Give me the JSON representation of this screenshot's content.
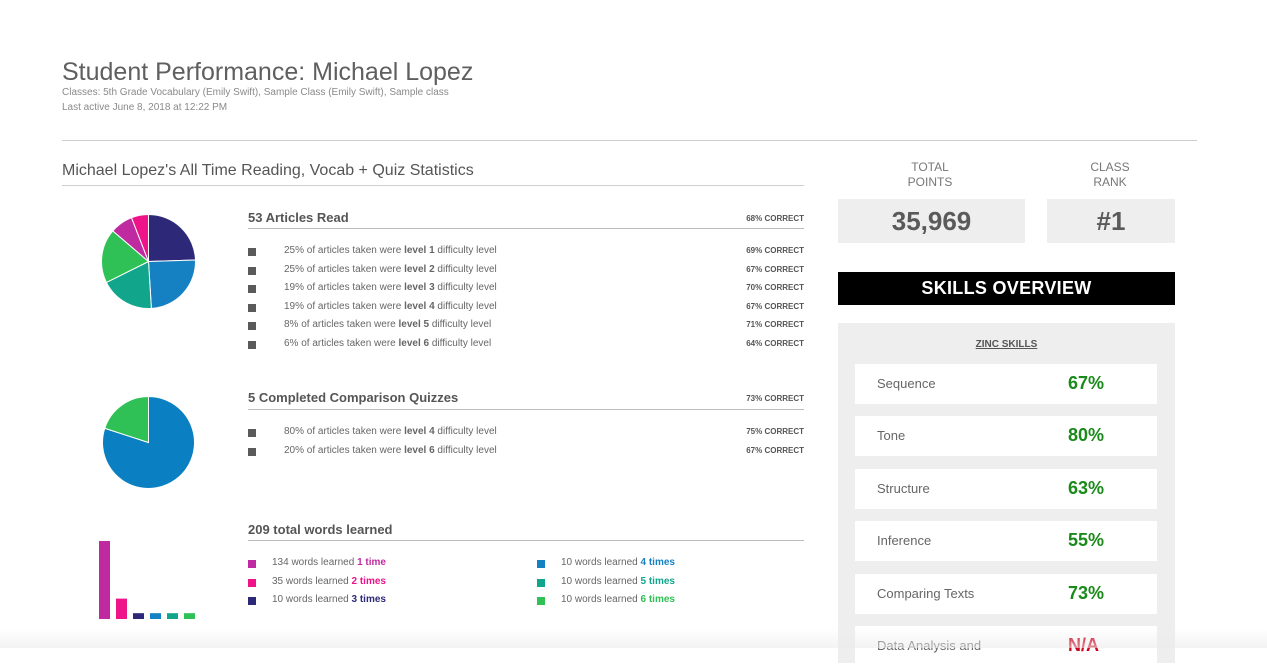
{
  "header": {
    "title": "Student Performance:  Michael Lopez",
    "classes": "Classes: 5th Grade Vocabulary (Emily Swift), Sample Class (Emily Swift), Sample class",
    "last_active": "Last active June 8, 2018 at 12:22 PM"
  },
  "stats_heading": "Michael Lopez's All Time Reading, Vocab + Quiz Statistics",
  "articles": {
    "title": "53 Articles Read",
    "correct": "68% CORRECT",
    "rows": [
      {
        "pre": "25% of articles taken were ",
        "level": "level 1",
        "post": " difficulty level",
        "correct": "69% CORRECT",
        "pct": 25
      },
      {
        "pre": "25% of articles taken were ",
        "level": "level 2",
        "post": " difficulty level",
        "correct": "67% CORRECT",
        "pct": 25
      },
      {
        "pre": "19% of articles taken were ",
        "level": "level 3",
        "post": " difficulty level",
        "correct": "70% CORRECT",
        "pct": 19
      },
      {
        "pre": "19% of articles taken were ",
        "level": "level 4",
        "post": " difficulty level",
        "correct": "67% CORRECT",
        "pct": 19
      },
      {
        "pre": "8% of articles taken were ",
        "level": "level 5",
        "post": " difficulty level",
        "correct": "71% CORRECT",
        "pct": 8
      },
      {
        "pre": "6% of articles taken were ",
        "level": "level 6",
        "post": " difficulty level",
        "correct": "64% CORRECT",
        "pct": 6
      }
    ],
    "pie_colors": [
      "#2e2878",
      "#1581c2",
      "#11a68c",
      "#2fc155",
      "#c02aa0",
      "#ee1388"
    ]
  },
  "quizzes": {
    "title": "5 Completed Comparison Quizzes",
    "correct": "73% CORRECT",
    "rows": [
      {
        "pre": "80% of articles taken were ",
        "level": "level 4",
        "post": " difficulty level",
        "correct": "75% CORRECT",
        "pct": 80
      },
      {
        "pre": "20% of articles taken were ",
        "level": "level 6",
        "post": " difficulty level",
        "correct": "67% CORRECT",
        "pct": 20
      }
    ],
    "pie_colors": [
      "#0a80c2",
      "#2fc155"
    ]
  },
  "words": {
    "title": "209 total words learned",
    "items": [
      {
        "pre": "134 words learned ",
        "times": "1 time",
        "count": 134,
        "color": "#c02aa0"
      },
      {
        "pre": "35 words learned ",
        "times": "2 times",
        "count": 35,
        "color": "#ee1388"
      },
      {
        "pre": "10 words learned ",
        "times": "3 times",
        "count": 10,
        "color": "#2e2878"
      },
      {
        "pre": "10 words learned ",
        "times": "4 times",
        "count": 10,
        "color": "#1581c2"
      },
      {
        "pre": "10 words learned ",
        "times": "5 times",
        "count": 10,
        "color": "#11a68c"
      },
      {
        "pre": "10 words learned ",
        "times": "6 times",
        "count": 10,
        "color": "#2fc155"
      }
    ]
  },
  "total_points": {
    "label_line1": "TOTAL",
    "label_line2": "POINTS",
    "value": "35,969"
  },
  "class_rank": {
    "label_line1": "CLASS",
    "label_line2": "RANK",
    "value": "#1"
  },
  "skills": {
    "banner": "SKILLS OVERVIEW",
    "group_label": "ZINC SKILLS",
    "items": [
      {
        "name": "Sequence",
        "value": "67%",
        "color": "#1a8a1a"
      },
      {
        "name": "Tone",
        "value": "80%",
        "color": "#1a8a1a"
      },
      {
        "name": "Structure",
        "value": "63%",
        "color": "#1a8a1a"
      },
      {
        "name": "Inference",
        "value": "55%",
        "color": "#1a8a1a"
      },
      {
        "name": "Comparing Texts",
        "value": "73%",
        "color": "#1a8a1a"
      },
      {
        "name": "Data Analysis and",
        "value": "N/A",
        "color": "#d0021b"
      }
    ]
  }
}
